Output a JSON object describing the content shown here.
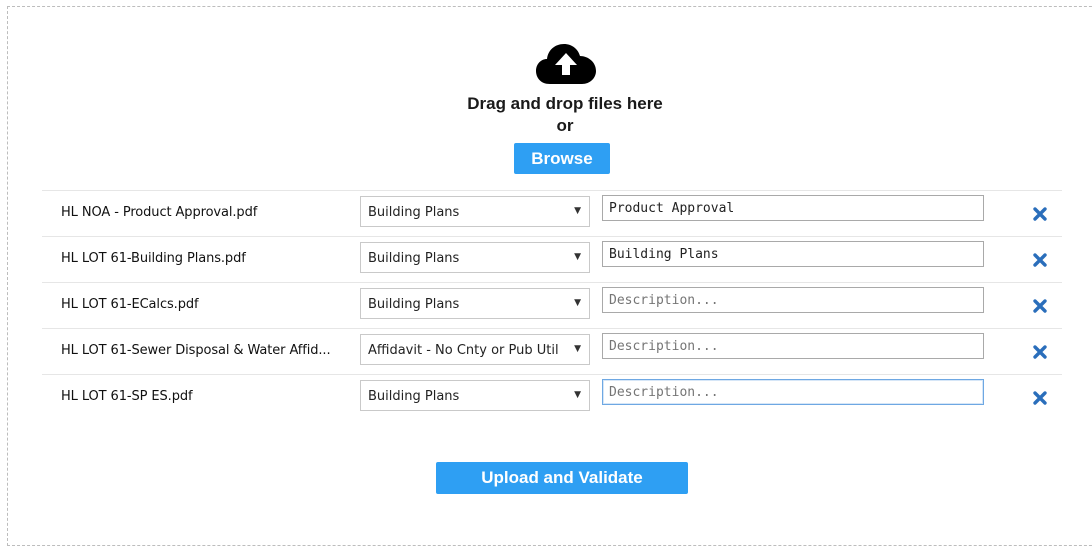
{
  "uploader": {
    "cloud_icon": "cloud-upload-icon",
    "drag_text": "Drag and drop files here",
    "or_text": "or",
    "browse_label": "Browse",
    "accent_color": "#2e9ff3"
  },
  "files": [
    {
      "name": "HL NOA - Product Approval.pdf",
      "type": "Building Plans",
      "description": "Product Approval",
      "placeholder": "Description..."
    },
    {
      "name": "HL LOT 61-Building Plans.pdf",
      "type": "Building Plans",
      "description": "Building Plans",
      "placeholder": "Description..."
    },
    {
      "name": "HL LOT 61-ECalcs.pdf",
      "type": "Building Plans",
      "description": "",
      "placeholder": "Description..."
    },
    {
      "name": "HL LOT 61-Sewer Disposal & Water Affid...",
      "type": "Affidavit - No Cnty or Pub Util",
      "description": "",
      "placeholder": "Description..."
    },
    {
      "name": "HL LOT 61-SP ES.pdf",
      "type": "Building Plans",
      "description": "",
      "placeholder": "Description..."
    }
  ],
  "actions": {
    "upload_label": "Upload and Validate",
    "remove_icon": "close-x-icon"
  }
}
